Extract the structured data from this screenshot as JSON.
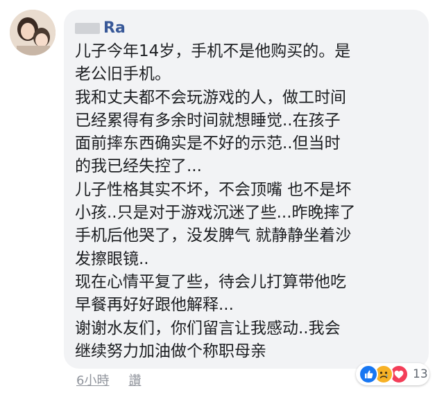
{
  "comment": {
    "author_name": "Ra",
    "text": "儿子今年14岁，手机不是他购买的。是\n老公旧手机。\n我和丈夫都不会玩游戏的人，做工时间\n已经累得有多余时间就想睡觉..在孩子\n面前摔东西确实是不好的示范..但当时\n的我已经失控了...\n儿子性格其实不坏，不会顶嘴 也不是坏\n小孩..只是对于游戏沉迷了些...昨晚摔了\n手机后他哭了，没发脾气 就静静坐着沙\n发擦眼镜..\n现在心情平复了些，待会儿打算带他吃\n早餐再好好跟他解释...\n谢谢水友们，你们留言让我感动..我会\n继续努力加油做个称职母亲"
  },
  "actions": {
    "timestamp": "6小時",
    "like_label": "讚"
  },
  "reactions": {
    "icons": [
      "like-icon",
      "sad-icon",
      "love-icon"
    ],
    "count": "13",
    "colors": {
      "like": "#1877f2",
      "sad": "#f7b125",
      "love": "#f33e58"
    }
  },
  "colors": {
    "bubble": "#f2f3f5",
    "name": "#385898",
    "meta": "#90949c"
  }
}
